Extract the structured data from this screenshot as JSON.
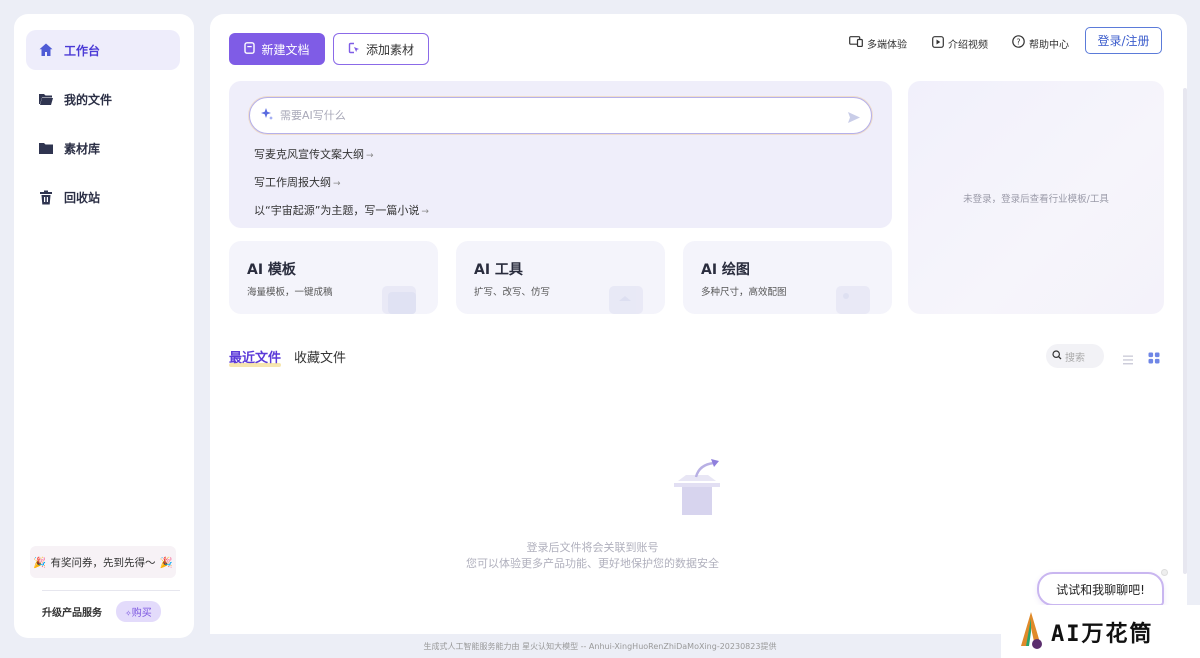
{
  "sidebar": {
    "items": [
      {
        "label": "工作台",
        "icon": "home-icon",
        "active": true
      },
      {
        "label": "我的文件",
        "icon": "folder-open-icon",
        "active": false
      },
      {
        "label": "素材库",
        "icon": "folder-icon",
        "active": false
      },
      {
        "label": "回收站",
        "icon": "trash-icon",
        "active": false
      }
    ],
    "promo": "有奖问券，先到先得～",
    "upgrade_label": "升级产品服务",
    "buy_label": "购买"
  },
  "toolbar": {
    "new_doc": "新建文档",
    "add_material": "添加素材",
    "multi_device": "多端体验",
    "intro_video": "介绍视频",
    "help_center": "帮助中心",
    "login": "登录/注册"
  },
  "ai_input": {
    "placeholder": "需要AI写什么",
    "suggestions": [
      "写麦克风宣传文案大纲",
      "写工作周报大纲",
      "以“宇宙起源”为主题，写一篇小说"
    ]
  },
  "side_card": {
    "text": "未登录，登录后查看行业模板/工具"
  },
  "cards": [
    {
      "title": "AI 模板",
      "sub": "海量模板，一键成稿"
    },
    {
      "title": "AI 工具",
      "sub": "扩写、改写、仿写"
    },
    {
      "title": "AI 绘图",
      "sub": "多种尺寸，高效配图"
    }
  ],
  "files": {
    "tabs": [
      "最近文件",
      "收藏文件"
    ],
    "search_placeholder": "搜索",
    "empty_line1": "登录后文件将会关联到账号",
    "empty_line2": "您可以体验更多产品功能、更好地保护您的数据安全"
  },
  "chat": {
    "label": "试试和我聊聊吧!"
  },
  "footer": "生成式人工智能服务能力由 星火认知大模型 -- Anhui-XingHuoRenZhiDaMoXing-20230823提供",
  "watermark": "AI万花筒",
  "colors": {
    "accent": "#7f5ce6",
    "login_blue": "#3c5dcc",
    "tab_active": "#5b3ad8"
  }
}
